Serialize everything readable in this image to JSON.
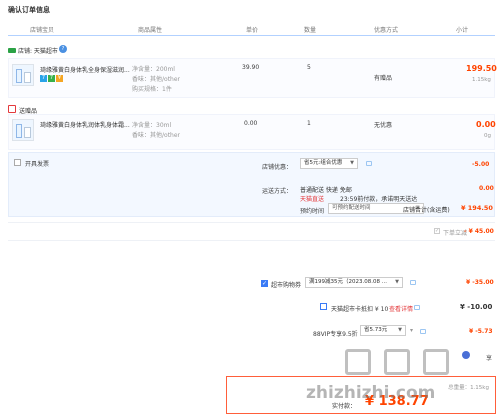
{
  "page": {
    "title": "确认订单信息"
  },
  "columns": [
    "店铺宝贝",
    "商品属性",
    "单价",
    "数量",
    "优惠方式",
    "小计"
  ],
  "shop1": {
    "label": "店铺: 天猫超市"
  },
  "item1": {
    "name": "琦缘雅黄白身体乳全身保湿滋润...",
    "attr1": "净含量：200ml",
    "attr2": "香味：其他/other",
    "attr3": "购买规格：1件",
    "price": "39.90",
    "qty": "5",
    "promo": "有赠品",
    "subtotal": "199.50",
    "weight": "1.15kg"
  },
  "gift_section": {
    "label": "送赠品"
  },
  "item2": {
    "name": "琦缘雅黄白身体乳润体乳身体霜...",
    "attr1": "净含量：30ml",
    "attr2": "香味：其他/other",
    "price": "0.00",
    "qty": "1",
    "promo": "无优惠",
    "subtotal": "0.00",
    "weight": "0g"
  },
  "invoice": {
    "label": "开具发票"
  },
  "shop_discount": {
    "label": "店铺优惠：",
    "select": "省5元:组合优惠",
    "amount": "-5.00"
  },
  "delivery": {
    "label": "运送方式：",
    "method": "普通配送 快递 免邮",
    "tmall_label": "天猫直送",
    "note": "23:59前付款，承诺明天送达",
    "amount": "0.00",
    "appt_label": "预约时间",
    "appt_placeholder": "可预约配送时间"
  },
  "shop_total": {
    "label": "店铺合计(含运费)",
    "amount": "¥ 194.50"
  },
  "order_discount": {
    "label": "下单立减",
    "amount": "- ¥ 45.00"
  },
  "supermarket_coupon": {
    "label": "超市购物券",
    "select": "满199减35元（2023.08.08 ...",
    "amount": "¥ -35.00"
  },
  "card_coupon": {
    "label": "天猫超市卡抵扣 ¥ 10",
    "link": "查看详情",
    "amount": "¥ -10.00"
  },
  "vip_discount": {
    "label": "88VIP专享9.5折",
    "select": "省5.73元",
    "amount": "¥ -5.73",
    "side": "享"
  },
  "summary": {
    "weight": "总重量：1.15kg",
    "label": "实付款：",
    "amount": "¥ 138.77"
  },
  "watermark": {
    "text": "zhizhizhi.com",
    "chars": "值值值"
  },
  "colors": {
    "accent": "#ff4400",
    "blue": "#3a7bf6",
    "border": "#b2d1ff"
  },
  "icons": [
    "tmall-icon",
    "help-icon",
    "gift-icon",
    "message-icon",
    "checkbox",
    "chevron-down-icon",
    "calendar-icon"
  ]
}
